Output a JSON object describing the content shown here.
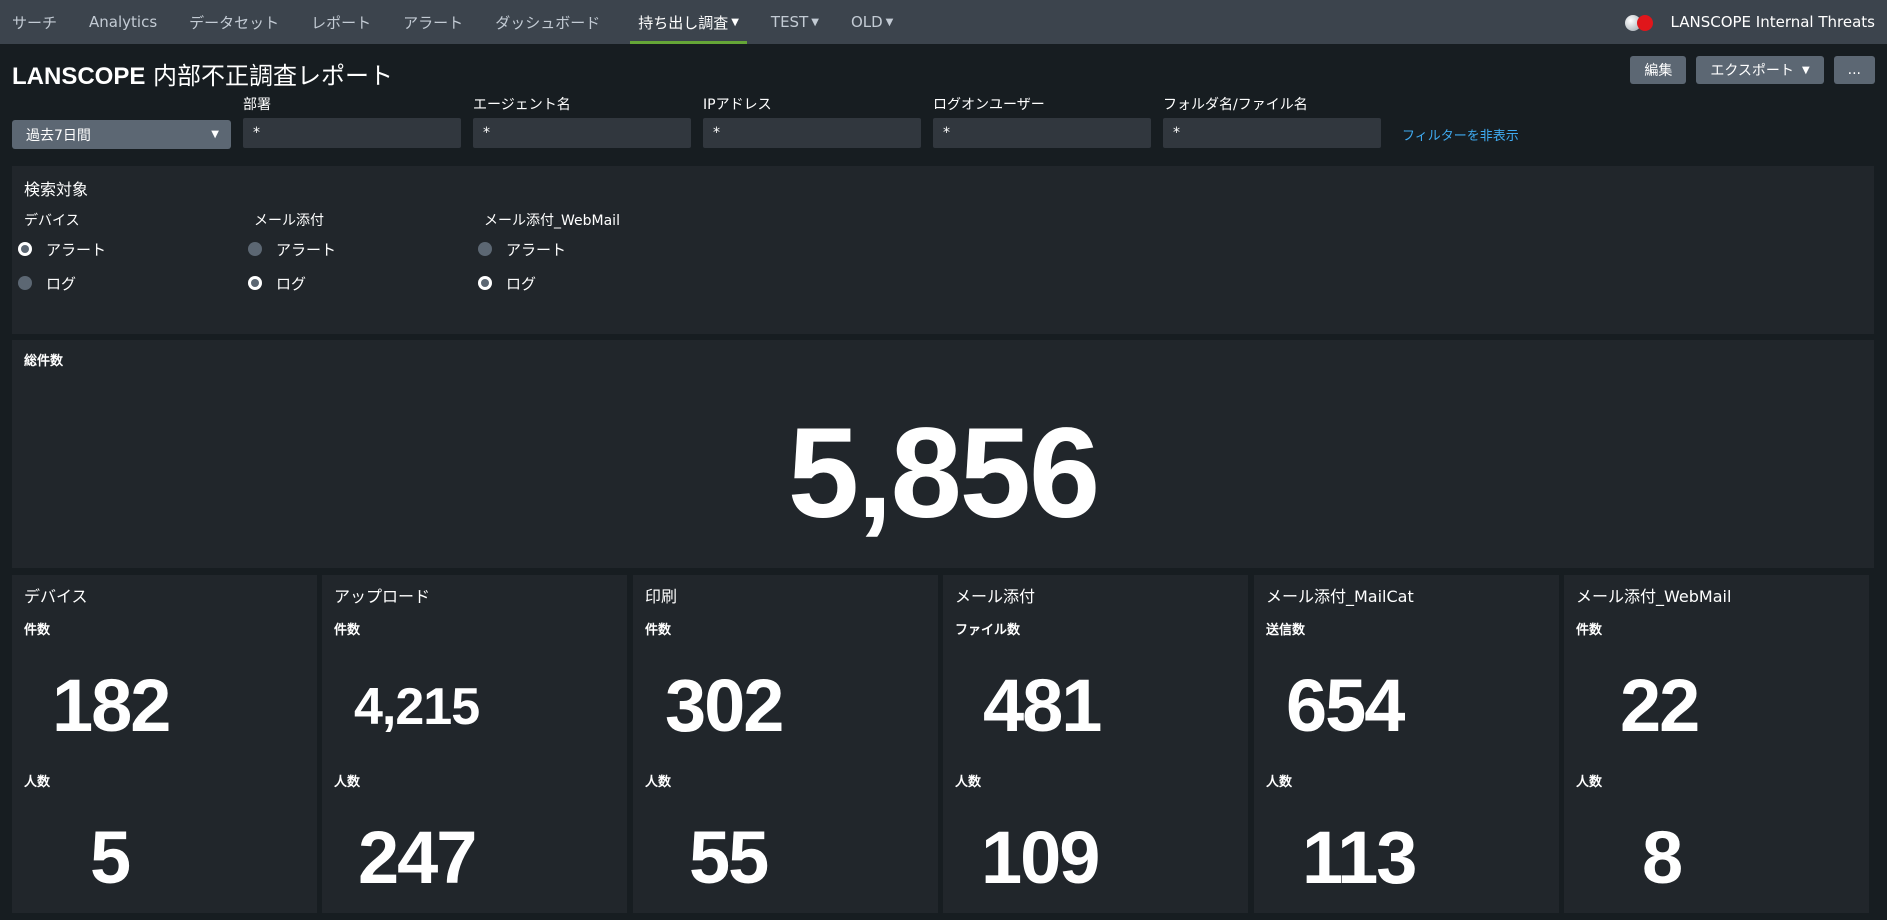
{
  "nav": {
    "items": [
      {
        "label": "サーチ"
      },
      {
        "label": "Analytics"
      },
      {
        "label": "データセット"
      },
      {
        "label": "レポート"
      },
      {
        "label": "アラート"
      },
      {
        "label": "ダッシュボード"
      },
      {
        "label": "持ち出し調査",
        "active": true
      },
      {
        "label": "TEST"
      },
      {
        "label": "OLD"
      }
    ],
    "app_name": "LANSCOPE Internal Threats"
  },
  "header": {
    "title_latin": "LANSCOPE",
    "title_jp": " 内部不正調査レポート",
    "edit_label": "編集",
    "export_label": "エクスポート",
    "more_label": "..."
  },
  "filters": {
    "time_range": "過去7日間",
    "fields": [
      {
        "label": "部署",
        "value": "*"
      },
      {
        "label": "エージェント名",
        "value": "*"
      },
      {
        "label": "IPアドレス",
        "value": "*"
      },
      {
        "label": "ログオンユーザー",
        "value": "*"
      },
      {
        "label": "フォルダ名/ファイル名",
        "value": "*"
      }
    ],
    "hide_link": "フィルターを非表示"
  },
  "search_target": {
    "title": "検索対象",
    "groups": [
      {
        "title": "デバイス",
        "options": [
          {
            "label": "アラート",
            "checked": true
          },
          {
            "label": "ログ",
            "checked": false
          }
        ]
      },
      {
        "title": "メール添付",
        "options": [
          {
            "label": "アラート",
            "checked": false
          },
          {
            "label": "ログ",
            "checked": true
          }
        ]
      },
      {
        "title": "メール添付_WebMail",
        "options": [
          {
            "label": "アラート",
            "checked": false
          },
          {
            "label": "ログ",
            "checked": true
          }
        ]
      }
    ]
  },
  "total": {
    "title": "総件数",
    "value": "5,856"
  },
  "stats": [
    {
      "title": "デバイス",
      "label1": "件数",
      "value1": "182",
      "label2": "人数",
      "value2": "5"
    },
    {
      "title": "アップロード",
      "label1": "件数",
      "value1": "4,215",
      "label2": "人数",
      "value2": "247"
    },
    {
      "title": "印刷",
      "label1": "件数",
      "value1": "302",
      "label2": "人数",
      "value2": "55"
    },
    {
      "title": "メール添付",
      "label1": "ファイル数",
      "value1": "481",
      "label2": "人数",
      "value2": "109"
    },
    {
      "title": "メール添付_MailCat",
      "label1": "送信数",
      "value1": "654",
      "label2": "人数",
      "value2": "113"
    },
    {
      "title": "メール添付_WebMail",
      "label1": "件数",
      "value1": "22",
      "label2": "人数",
      "value2": "8"
    }
  ]
}
